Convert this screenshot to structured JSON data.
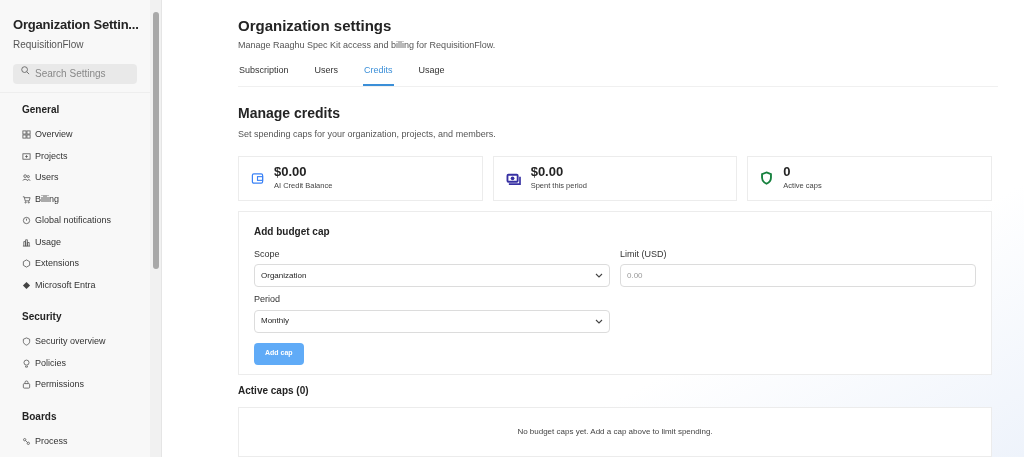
{
  "sidebar": {
    "title": "Organization Settin...",
    "subtitle": "RequisitionFlow",
    "search": {
      "placeholder": "Search Settings"
    },
    "sections": [
      {
        "heading": "General",
        "items": [
          {
            "label": "Overview",
            "kind": "grid"
          },
          {
            "label": "Projects",
            "kind": "project"
          },
          {
            "label": "Users",
            "kind": "users"
          },
          {
            "label": "Billing",
            "kind": "cart"
          },
          {
            "label": "Global notifications",
            "kind": "bell"
          },
          {
            "label": "Usage",
            "kind": "chart"
          },
          {
            "label": "Extensions",
            "kind": "puzzle"
          },
          {
            "label": "Microsoft Entra",
            "kind": "diamond"
          }
        ]
      },
      {
        "heading": "Security",
        "items": [
          {
            "label": "Security overview",
            "kind": "shield"
          },
          {
            "label": "Policies",
            "kind": "bulb"
          },
          {
            "label": "Permissions",
            "kind": "lock"
          }
        ]
      },
      {
        "heading": "Boards",
        "items": [
          {
            "label": "Process",
            "kind": "process"
          }
        ]
      }
    ]
  },
  "page": {
    "title": "Organization settings",
    "subtitle": "Manage Raaghu Spec Kit access and billing for RequisitionFlow.",
    "tabs": [
      {
        "label": "Subscription",
        "selected": false
      },
      {
        "label": "Users",
        "selected": false
      },
      {
        "label": "Credits",
        "selected": true
      },
      {
        "label": "Usage",
        "selected": false
      }
    ]
  },
  "credits": {
    "title": "Manage credits",
    "subtitle": "Set spending caps for your organization, projects, and members.",
    "stats": [
      {
        "value": "$0.00",
        "label": "AI Credit Balance",
        "kind": "wallet",
        "color": "#3b82f6"
      },
      {
        "value": "$0.00",
        "label": "Spent this period",
        "kind": "money",
        "color": "#3730a3"
      },
      {
        "value": "0",
        "label": "Active caps",
        "kind": "shield",
        "color": "#15803d"
      }
    ],
    "form": {
      "title": "Add budget cap",
      "scope": {
        "label": "Scope",
        "value": "Organization"
      },
      "limit": {
        "label": "Limit (USD)",
        "placeholder": "0.00"
      },
      "period": {
        "label": "Period",
        "value": "Monthly"
      },
      "button": "Add cap"
    },
    "active": {
      "title": "Active caps (0)",
      "empty": "No budget caps yet. Add a cap above to limit spending."
    }
  }
}
